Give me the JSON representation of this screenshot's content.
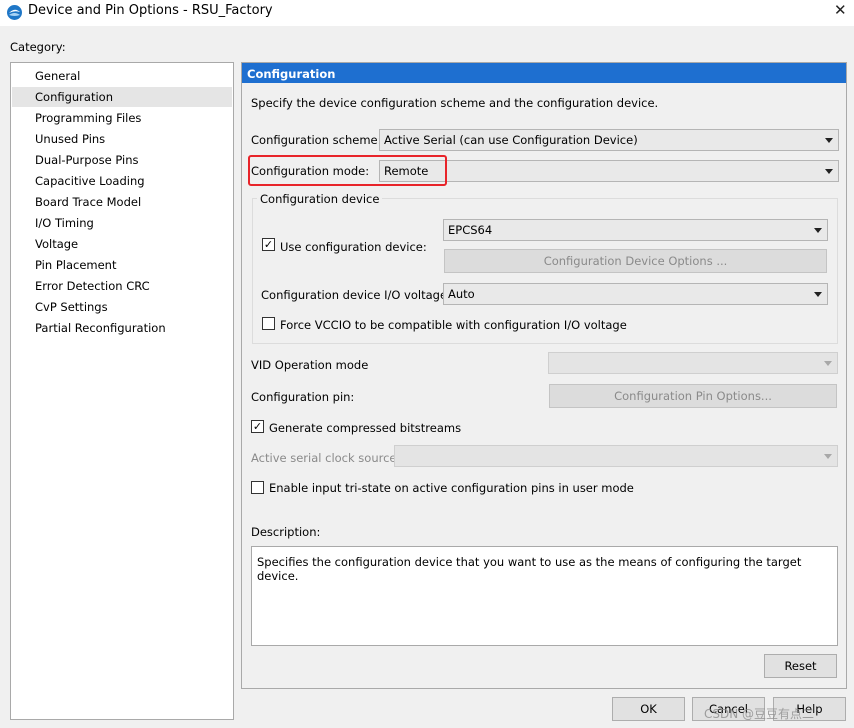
{
  "window": {
    "title": "Device and Pin Options - RSU_Factory",
    "close_glyph": "✕"
  },
  "category": {
    "label": "Category:",
    "items": [
      "General",
      "Configuration",
      "Programming Files",
      "Unused Pins",
      "Dual-Purpose Pins",
      "Capacitive Loading",
      "Board Trace Model",
      "I/O Timing",
      "Voltage",
      "Pin Placement",
      "Error Detection CRC",
      "CvP Settings",
      "Partial Reconfiguration"
    ],
    "selected_index": 1
  },
  "panel": {
    "header": "Configuration",
    "intro": "Specify the device configuration scheme and the configuration device.",
    "scheme_label": "Configuration scheme:",
    "scheme_value": "Active Serial (can use Configuration Device)",
    "mode_label": "Configuration mode:",
    "mode_value": "Remote",
    "device_group_title": "Configuration device",
    "use_device_label": "Use configuration device:",
    "use_device_checked": true,
    "device_value": "EPCS64",
    "device_options_button": "Configuration Device Options ...",
    "io_voltage_label": "Configuration device I/O voltage:",
    "io_voltage_value": "Auto",
    "force_vccio_label": "Force VCCIO to be compatible with configuration I/O voltage",
    "force_vccio_checked": false,
    "vid_label": "VID Operation mode",
    "vid_value": "",
    "pin_label": "Configuration pin:",
    "pin_button": "Configuration Pin Options...",
    "compressed_label": "Generate compressed bitstreams",
    "compressed_checked": true,
    "clock_label": "Active serial clock source:",
    "clock_value": "",
    "tristate_label": "Enable input tri-state on active configuration pins in user mode",
    "tristate_checked": false,
    "description_label": "Description:",
    "description_text": "Specifies the configuration device that you want to use as the means of configuring the target device.",
    "reset_button": "Reset"
  },
  "footer": {
    "ok": "OK",
    "cancel": "Cancel",
    "help": "Help"
  },
  "watermark": "CSDN @豆豆有点二",
  "colors": {
    "header_blue": "#1e6fd0",
    "highlight_red": "#e8242a",
    "selection_gray": "#e5e5e5"
  }
}
